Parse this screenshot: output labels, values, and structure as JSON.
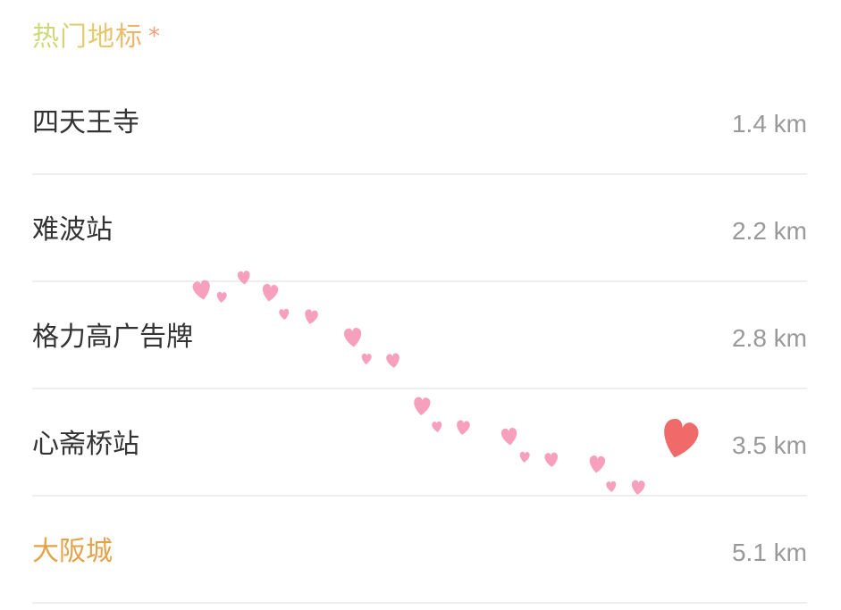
{
  "section": {
    "title": "热门地标",
    "title_mark": "*"
  },
  "landmarks": [
    {
      "name": "四天王寺",
      "distance": "1.4 km"
    },
    {
      "name": "难波站",
      "distance": "2.2 km"
    },
    {
      "name": "格力高广告牌",
      "distance": "2.8 km"
    },
    {
      "name": "心斋桥站",
      "distance": "3.5 km"
    },
    {
      "name": "大阪城",
      "distance": "5.1 km"
    }
  ],
  "colors": {
    "heart_trail": "#f48fb1",
    "heart_big": "#f06a6a",
    "highlight_text": "#e3a34a"
  },
  "icons": {
    "trail": "heart-icon",
    "end": "heart-icon"
  }
}
